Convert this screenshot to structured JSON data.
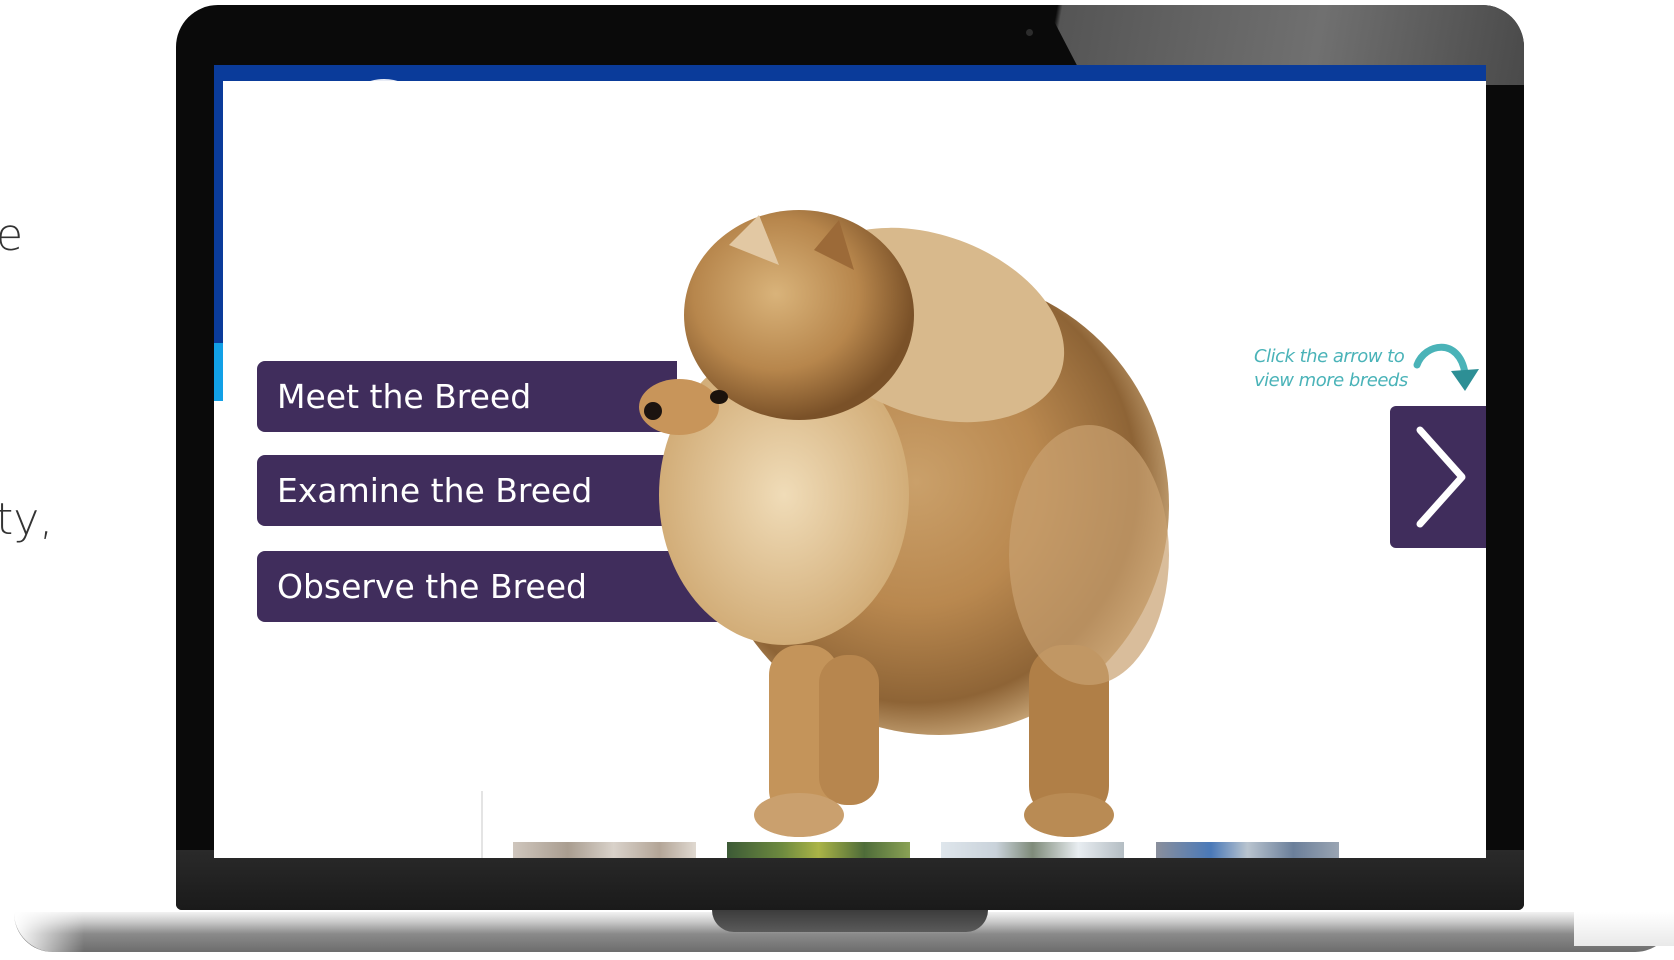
{
  "side_text": [
    "e",
    "ty,"
  ],
  "menu": {
    "items": [
      {
        "id": "meet",
        "label": "Meet the Breed"
      },
      {
        "id": "examine",
        "label": "Examine the Breed"
      },
      {
        "id": "observe",
        "label": "Observe the Breed"
      }
    ]
  },
  "hint": {
    "line1": "Click the arrow to",
    "line2": "view more breeds"
  },
  "icons": {
    "next": "chevron-right-icon",
    "hint_arrow": "curved-arrow-icon",
    "hero": "pomeranian-dog-photo"
  },
  "colors": {
    "header_blue": "#0a3b9a",
    "accent_blue": "#12a0e6",
    "button_purple": "#402d5c",
    "hint_teal": "#4ab3b8"
  }
}
